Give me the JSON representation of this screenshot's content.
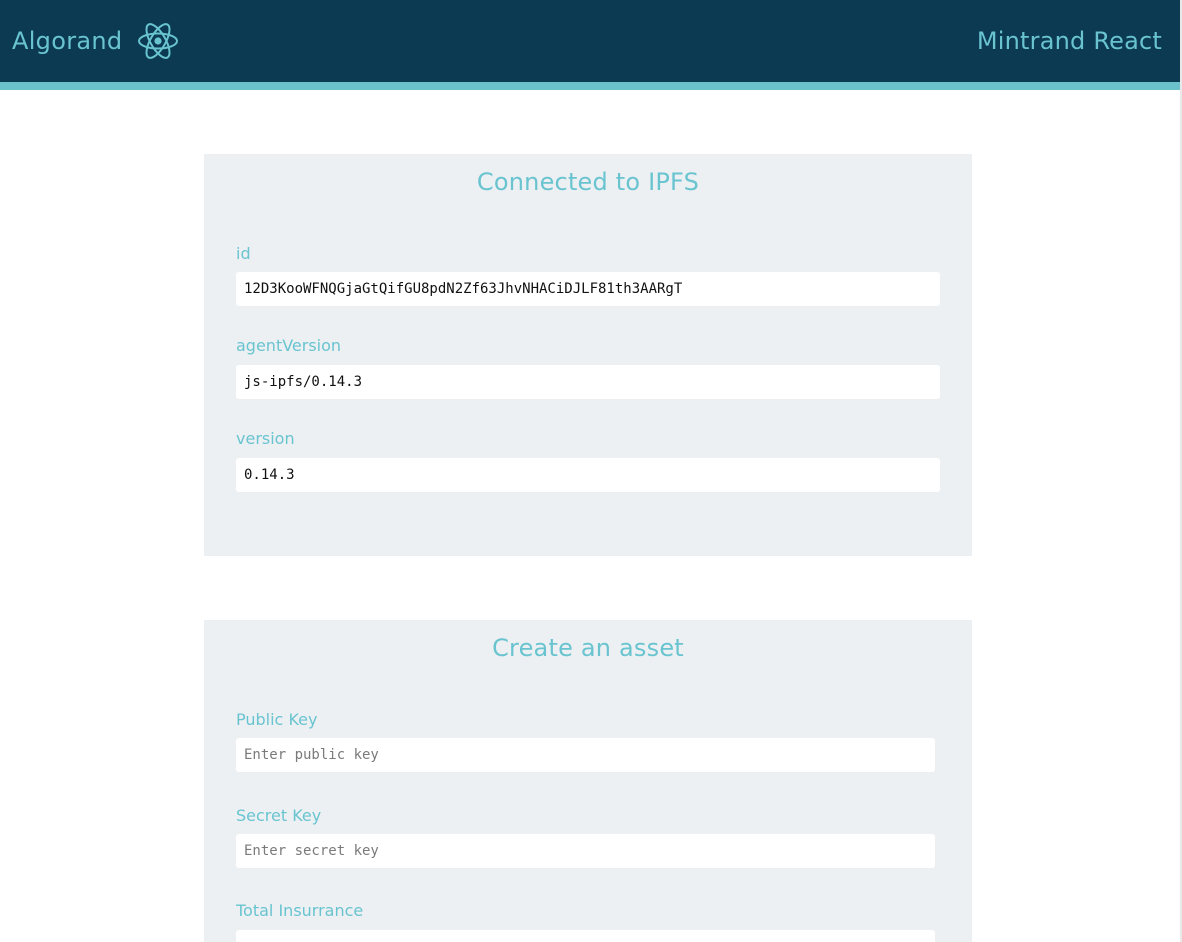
{
  "header": {
    "brand": "Algorand",
    "logo_icon": "react-atom-icon",
    "app_title": "Mintrand React",
    "colors": {
      "background": "#0b3a52",
      "accent": "#6bc2ca",
      "text": "#69c4d0"
    }
  },
  "ipfs": {
    "title": "Connected to IPFS",
    "fields": [
      {
        "label": "id",
        "value": "12D3KooWFNQGjaGtQifGU8pdN2Zf63JhvNHACiDJLF81th3AARgT"
      },
      {
        "label": "agentVersion",
        "value": "js-ipfs/0.14.3"
      },
      {
        "label": "version",
        "value": "0.14.3"
      }
    ]
  },
  "asset": {
    "title": "Create an asset",
    "fields": [
      {
        "label": "Public Key",
        "value": "",
        "placeholder": "Enter public key"
      },
      {
        "label": "Secret Key",
        "value": "",
        "placeholder": "Enter secret key"
      },
      {
        "label": "Total Insurrance",
        "value": "",
        "placeholder": ""
      }
    ]
  }
}
